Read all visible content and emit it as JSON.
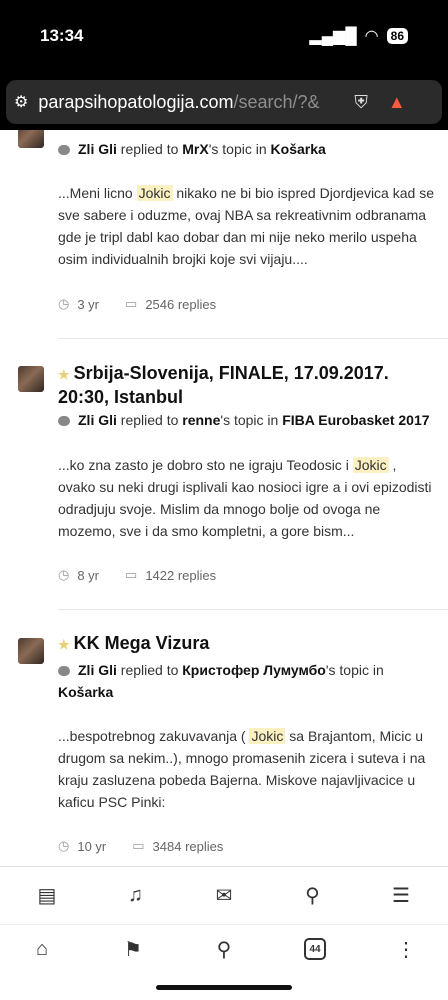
{
  "status": {
    "time": "13:34",
    "battery": "86"
  },
  "browser": {
    "url_host": "parapsihopatologija.com",
    "url_path": "/search/?&",
    "tab_count": "44"
  },
  "results": [
    {
      "title": "",
      "author": "Zli Gli",
      "replied_to": "replied to",
      "target_user": "MrX",
      "topic_in": "'s topic in",
      "forum": "Košarka",
      "snippet_before": "...Meni licno ",
      "highlight": "Jokic",
      "snippet_after": " nikako ne bi bio ispred Djordjevica kad se sve sabere i oduzme, ovaj NBA sa rekreativnim odbranama gde je tripl dabl kao dobar dan mi nije neko merilo uspeha osim individualnih brojki koje svi vijaju....",
      "age": "3 yr",
      "replies": "2546 replies"
    },
    {
      "title": "Srbija-Slovenija, FINALE, 17.09.2017. 20:30, Istanbul",
      "author": "Zli Gli",
      "replied_to": "replied to",
      "target_user": "renne",
      "topic_in": "'s topic in",
      "forum": "FIBA Eurobasket 2017",
      "snippet_before": "...ko zna zasto je dobro sto ne igraju Teodosic i ",
      "highlight": "Jokic",
      "snippet_after": " , ovako su neki drugi isplivali kao nosioci igre a i ovi epizodisti odradjuju svoje. Mislim da mnogo bolje od ovoga ne mozemo, sve i da smo kompletni, a gore bism...",
      "age": "8 yr",
      "replies": "1422 replies"
    },
    {
      "title": "KK Mega Vizura",
      "author": "Zli Gli",
      "replied_to": "replied to",
      "target_user": "Кристофер Лумумбо",
      "topic_in": "'s topic in",
      "forum": "Košarka",
      "snippet_before": "...bespotrebnog zakuvavanja ( ",
      "highlight": "Jokic",
      "snippet_after": " sa Brajantom, Micic u drugom sa nekim..), mnogo promasenih zicera i suteva i na kraju zasluzena pobeda Bajerna. Miskove najavljivacice u kaficu PSC Pinki:",
      "age": "10 yr",
      "replies": "3484 replies"
    }
  ]
}
